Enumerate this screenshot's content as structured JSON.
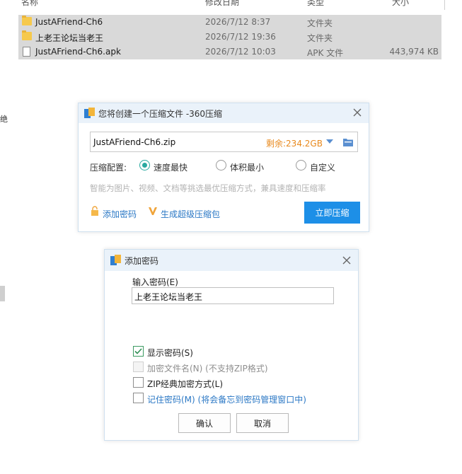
{
  "explorer": {
    "columns": [
      "名称",
      "修改日期",
      "类型",
      "大小"
    ],
    "files": [
      {
        "icon": "folder-icon",
        "name": "JustAFriend-Ch6",
        "date": "2026/7/12 8:37",
        "type": "文件夹",
        "size": ""
      },
      {
        "icon": "folder-icon",
        "name": "上老王论坛当老王",
        "date": "2026/7/12 19:36",
        "type": "文件夹",
        "size": ""
      },
      {
        "icon": "file-icon",
        "name": "JustAFriend-Ch6.apk",
        "date": "2026/7/12 10:03",
        "type": "APK 文件",
        "size": "443,974 KB"
      }
    ],
    "left_stub_text": "绝"
  },
  "compress_dialog": {
    "title": "您将创建一个压缩文件 -360压缩",
    "filename": "JustAFriend-Ch6.zip",
    "free_space": "剩余:234.2GB",
    "config_label": "压缩配置:",
    "options": [
      {
        "label": "速度最快",
        "selected": true
      },
      {
        "label": "体积最小",
        "selected": false
      },
      {
        "label": "自定义",
        "selected": false
      }
    ],
    "hint": "智能为图片、视频、文档等挑选最优压缩方式，兼具速度和压缩率",
    "add_password_link": "添加密码",
    "super_compress_link": "生成超级压缩包",
    "compress_button": "立即压缩",
    "accent_color": "#1d8fe7"
  },
  "password_dialog": {
    "title": "添加密码",
    "input_label": "输入密码(E)",
    "password_value": "上老王论坛当老王",
    "checkboxes": [
      {
        "label": "显示密码(S)",
        "checked": true,
        "disabled": false
      },
      {
        "label": "加密文件名(N) (不支持ZIP格式)",
        "checked": false,
        "disabled": true
      },
      {
        "label": "ZIP经典加密方式(L)",
        "checked": false,
        "disabled": false
      },
      {
        "label": "记住密码(M) (将会备忘到密码管理窗口中)",
        "checked": false,
        "disabled": false
      }
    ],
    "ok_button": "确认",
    "cancel_button": "取消"
  }
}
